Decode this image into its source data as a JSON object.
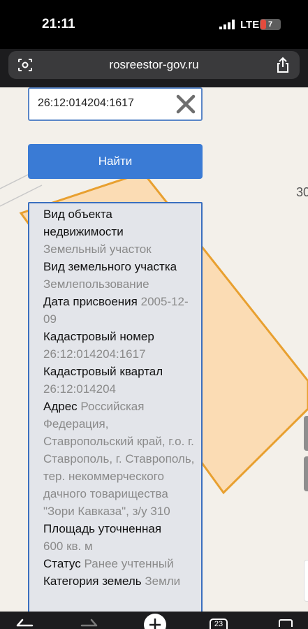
{
  "status_bar": {
    "time": "21:11",
    "network": "LTE",
    "battery": "7"
  },
  "browser": {
    "url": "rosreestor-gov.ru",
    "tab_count": "23"
  },
  "search": {
    "value": "26:12:014204:1617",
    "button_label": "Найти"
  },
  "map": {
    "partial_label": "30"
  },
  "info": [
    {
      "label": "Вид объекта недвижимости",
      "value": "Земельный участок"
    },
    {
      "label": "Вид земельного участка",
      "value": "Землепользование"
    },
    {
      "label": "Дата присвоения",
      "value": "2005-12-09"
    },
    {
      "label": "Кадастровый номер",
      "value": "26:12:014204:1617"
    },
    {
      "label": "Кадастровый квартал",
      "value": "26:12:014204"
    },
    {
      "label": "Адрес",
      "value": "Российская Федерация, Ставропольский край, г.о. г. Ставрополь, г. Ставрополь, тер. некоммерческого дачного товарищества \"Зори Кавказа\", з/у 310"
    },
    {
      "label": "Площадь уточненная",
      "value": "600 кв. м"
    },
    {
      "label": "Статус",
      "value": "Ранее учтенный"
    },
    {
      "label": "Категория земель",
      "value": "Земли"
    }
  ],
  "colors": {
    "accent": "#3a7bd5",
    "parcel_fill": "#fbdcb4",
    "parcel_stroke": "#e8a030"
  },
  "icons": [
    "camera-scan-icon",
    "share-icon",
    "clear-icon",
    "back-icon",
    "forward-icon",
    "new-tab-icon",
    "tabs-icon"
  ]
}
